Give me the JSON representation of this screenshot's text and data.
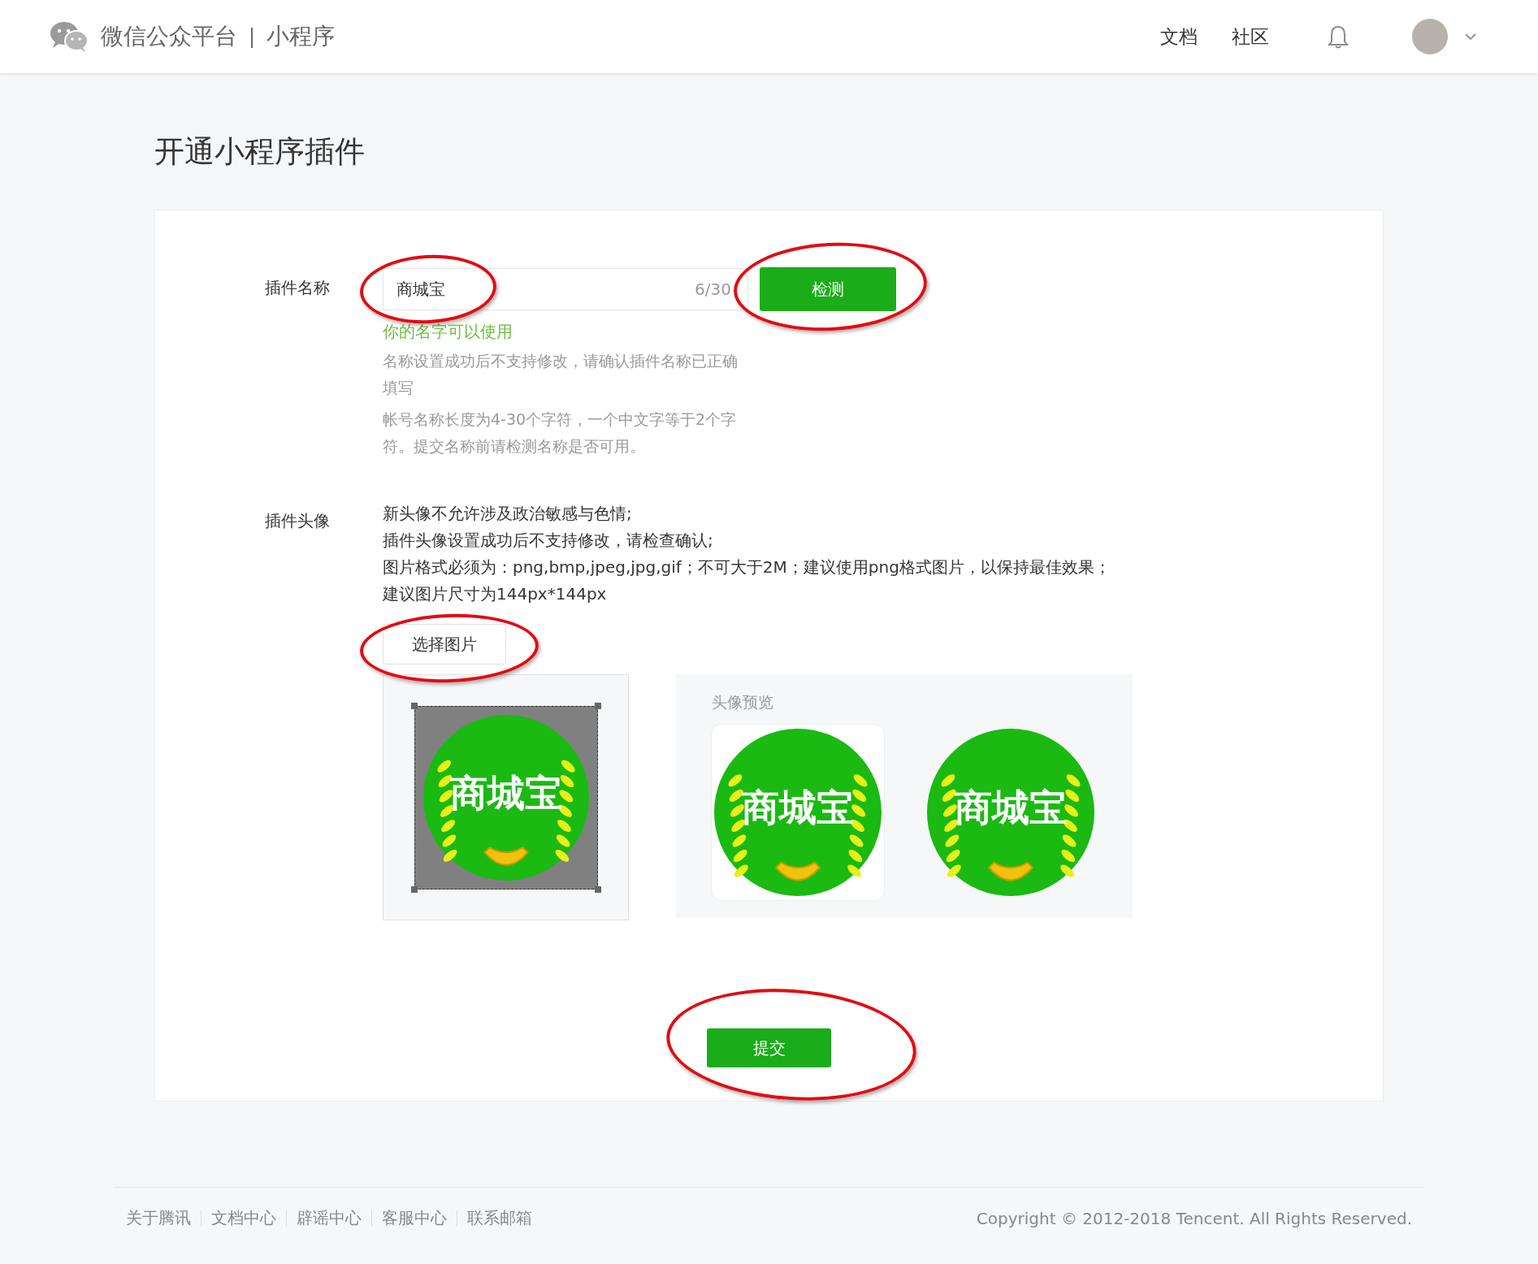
{
  "header": {
    "brand": "微信公众平台",
    "separator": "|",
    "product": "小程序",
    "nav": [
      "文档",
      "社区"
    ]
  },
  "page_title": "开通小程序插件",
  "form": {
    "name_label": "插件名称",
    "name_value": "商城宝",
    "name_counter": "6/30",
    "check_button": "检测",
    "name_status": "你的名字可以使用",
    "name_hints": [
      "名称设置成功后不支持修改，请确认插件名称已正确填写",
      "帐号名称长度为4-30个字符，一个中文字等于2个字符。提交名称前请检测名称是否可用。"
    ],
    "avatar_label": "插件头像",
    "avatar_rules": [
      "新头像不允许涉及政治敏感与色情;",
      "插件头像设置成功后不支持修改，请检查确认;",
      "图片格式必须为：png,bmp,jpeg,jpg,gif；不可大于2M；建议使用png格式图片，以保持最佳效果；建议图片尺寸为144px*144px"
    ],
    "choose_button": "选择图片",
    "editor_image_text": "商城宝",
    "preview": {
      "title": "头像预览",
      "items": [
        {
          "kind": "tile",
          "image_text": "商城宝"
        },
        {
          "kind": "round",
          "image_text": "商城宝"
        }
      ]
    },
    "submit_button": "提交"
  },
  "footer": {
    "links": [
      "关于腾讯",
      "文档中心",
      "辟谣中心",
      "客服中心",
      "联系邮箱"
    ],
    "copyright": "Copyright © 2012-2018 Tencent. All Rights Reserved."
  }
}
